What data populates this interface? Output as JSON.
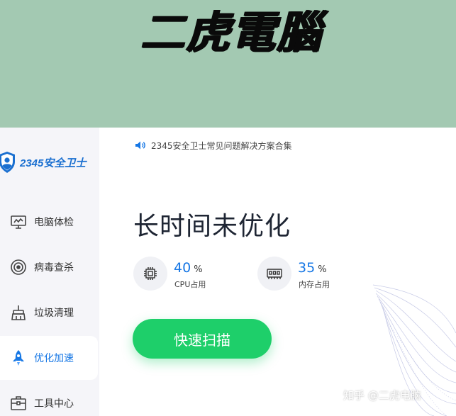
{
  "banner": {
    "title": "二虎電腦"
  },
  "brand": {
    "logo_text": "2345安全卫士",
    "accent": "#1a6fd0"
  },
  "notice": {
    "icon": "speaker-icon",
    "text": "2345安全卫士常见问题解决方案合集"
  },
  "status": {
    "title": "长时间未优化"
  },
  "metrics": [
    {
      "value": "40",
      "unit": "%",
      "label": "CPU占用",
      "icon": "cpu-icon"
    },
    {
      "value": "35",
      "unit": "%",
      "label": "内存占用",
      "icon": "memory-icon"
    }
  ],
  "nav": {
    "items": [
      {
        "label": "电脑体检",
        "icon": "monitor-icon",
        "active": false
      },
      {
        "label": "病毒查杀",
        "icon": "target-icon",
        "active": false
      },
      {
        "label": "垃圾清理",
        "icon": "broom-icon",
        "active": false
      },
      {
        "label": "优化加速",
        "icon": "rocket-icon",
        "active": true
      },
      {
        "label": "工具中心",
        "icon": "toolbox-icon",
        "active": false
      }
    ]
  },
  "actions": {
    "scan_label": "快速扫描",
    "scan_color": "#1ecf6a"
  },
  "watermark": {
    "text": "知乎 @二虎电脑"
  }
}
